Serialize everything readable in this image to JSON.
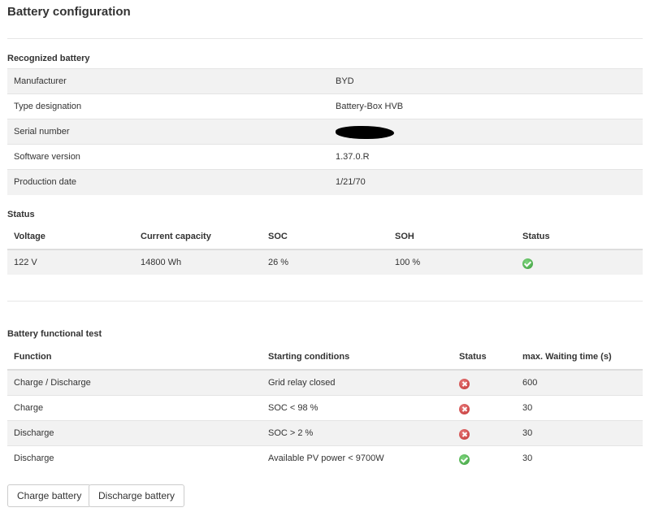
{
  "page": {
    "title": "Battery configuration"
  },
  "recognized": {
    "title": "Recognized battery",
    "rows": [
      {
        "label": "Manufacturer",
        "value": "BYD"
      },
      {
        "label": "Type designation",
        "value": "Battery-Box HVB"
      },
      {
        "label": "Serial number",
        "value": ""
      },
      {
        "label": "Software version",
        "value": "1.37.0.R"
      },
      {
        "label": "Production date",
        "value": "1/21/70"
      }
    ]
  },
  "status": {
    "title": "Status",
    "headers": [
      "Voltage",
      "Current capacity",
      "SOC",
      "SOH",
      "Status"
    ],
    "row": {
      "voltage": "122 V",
      "capacity": "14800 Wh",
      "soc": "26 %",
      "soh": "100 %",
      "status_icon": "check-circle-icon"
    }
  },
  "functional_test": {
    "title": "Battery functional test",
    "headers": [
      "Function",
      "Starting conditions",
      "Status",
      "max. Waiting time (s)"
    ],
    "rows": [
      {
        "function": "Charge / Discharge",
        "condition": "Grid relay closed",
        "status_icon": "x-circle-icon",
        "wait": "600"
      },
      {
        "function": "Charge",
        "condition": "SOC < 98 %",
        "status_icon": "x-circle-icon",
        "wait": "30"
      },
      {
        "function": "Discharge",
        "condition": "SOC > 2 %",
        "status_icon": "x-circle-icon",
        "wait": "30"
      },
      {
        "function": "Discharge",
        "condition": "Available PV power < 9700W",
        "status_icon": "check-circle-icon",
        "wait": "30"
      }
    ]
  },
  "buttons": {
    "charge": "Charge battery",
    "discharge": "Discharge battery"
  },
  "colors": {
    "ok": "#3a9b3a",
    "error": "#c03030",
    "stripe": "#f2f2f2"
  }
}
